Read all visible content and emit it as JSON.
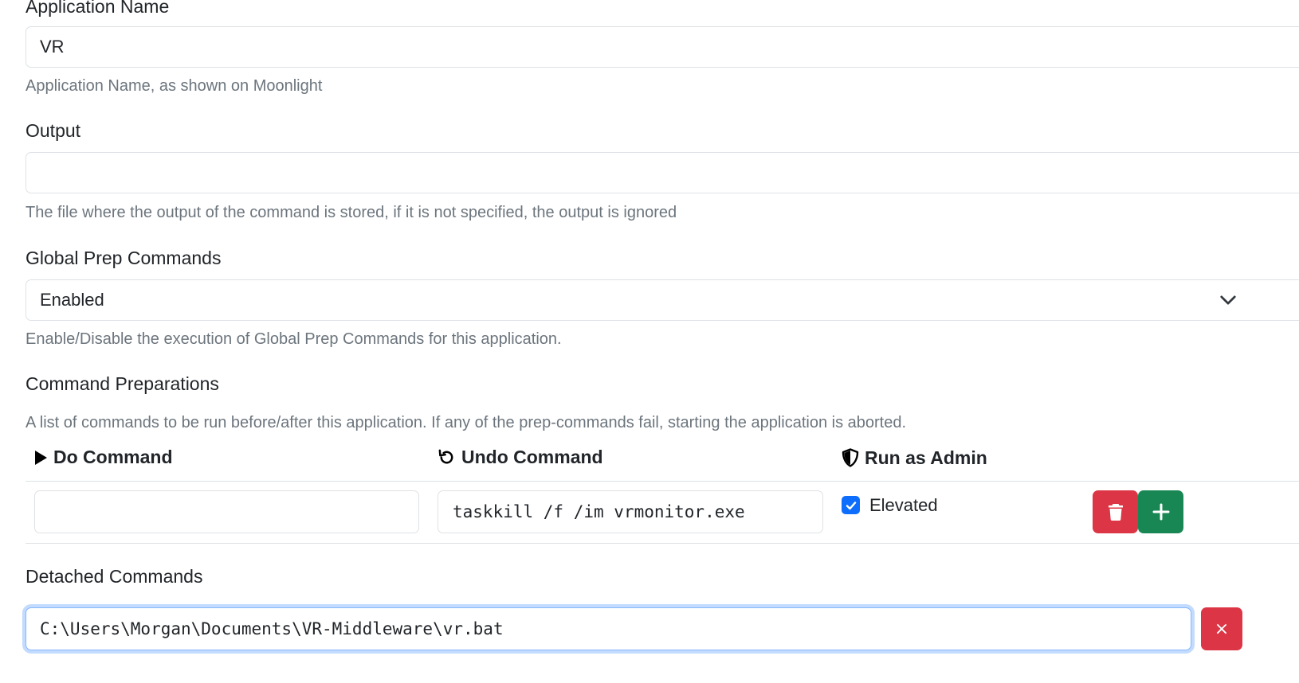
{
  "app_name": {
    "label": "Application Name",
    "value": "VR",
    "help": "Application Name, as shown on Moonlight"
  },
  "output": {
    "label": "Output",
    "value": "",
    "help": "The file where the output of the command is stored, if it is not specified, the output is ignored"
  },
  "global_prep": {
    "label": "Global Prep Commands",
    "selected": "Enabled",
    "help": "Enable/Disable the execution of Global Prep Commands for this application."
  },
  "command_preparations": {
    "label": "Command Preparations",
    "help": "A list of commands to be run before/after this application. If any of the prep-commands fail, starting the application is aborted.",
    "headers": {
      "do": "Do Command",
      "undo": "Undo Command",
      "admin": "Run as Admin"
    },
    "rows": [
      {
        "do": "",
        "undo": "taskkill /f /im vrmonitor.exe",
        "elevated_label": "Elevated",
        "elevated": true
      }
    ]
  },
  "detached_commands": {
    "label": "Detached Commands",
    "items": [
      "C:\\Users\\Morgan\\Documents\\VR-Middleware\\vr.bat"
    ],
    "remove_label": "×"
  },
  "colors": {
    "primary": "#0d6efd",
    "danger": "#dc3545",
    "success": "#198754",
    "muted": "#6c757d",
    "border": "#dee2e6"
  }
}
